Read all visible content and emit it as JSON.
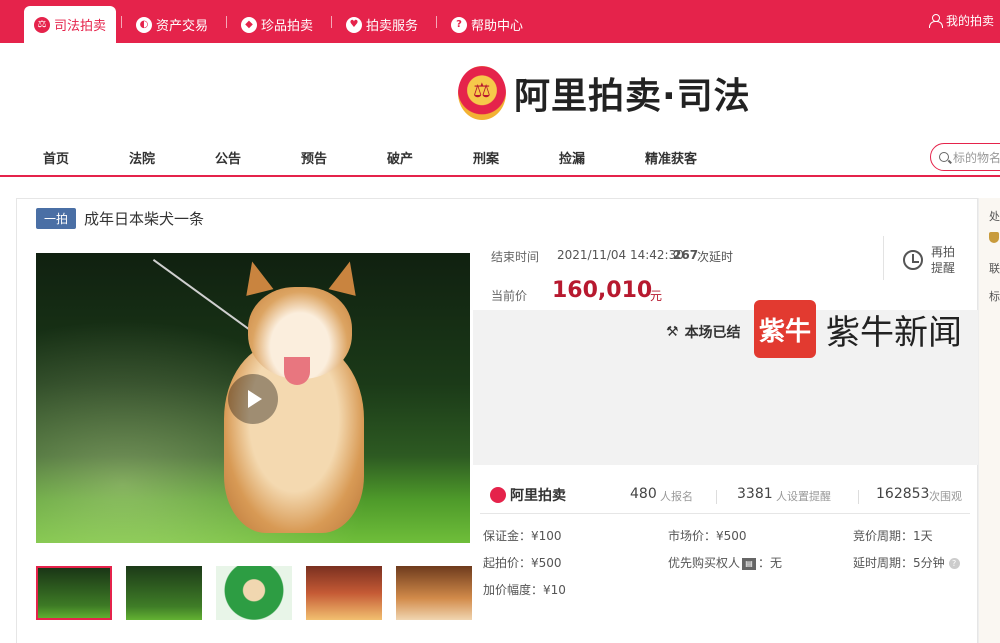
{
  "topbar": {
    "tabs": [
      {
        "label": "司法拍卖",
        "icon": "court-icon",
        "active": true
      },
      {
        "label": "资产交易",
        "icon": "asset-icon",
        "active": false
      },
      {
        "label": "珍品拍卖",
        "icon": "gem-icon",
        "active": false
      },
      {
        "label": "拍卖服务",
        "icon": "heart-icon",
        "active": false
      },
      {
        "label": "帮助中心",
        "icon": "help-icon",
        "active": false
      }
    ],
    "my_auction": "我的拍卖",
    "bg_color": "#e5234b"
  },
  "logo": {
    "text": "阿里拍卖·司法"
  },
  "nav": {
    "items": [
      "首页",
      "法院",
      "公告",
      "预告",
      "破产",
      "刑案",
      "捡漏",
      "精准获客"
    ],
    "search_placeholder": "标的物名"
  },
  "item": {
    "badge": "一拍",
    "title": "成年日本柴犬一条",
    "end_label": "结束时间",
    "end_time": "2021/11/04 14:42:30",
    "delay_count": "267",
    "delay_suffix": "次延时",
    "price_label": "当前价",
    "price": "160,010",
    "price_unit": "元",
    "remind_label": "再拍提醒",
    "ended_text": "本场已结",
    "watermark_box": "紫牛",
    "watermark_text": "紫牛新闻"
  },
  "stats": {
    "brand": "阿里拍卖",
    "signups": "480",
    "signups_label": "人报名",
    "reminders": "3381",
    "reminders_label": "人设置提醒",
    "views": "162853",
    "views_label": "次围观"
  },
  "details": {
    "deposit": "保证金：¥100",
    "market_price": "市场价：¥500",
    "bid_cycle": "竞价周期：1天",
    "start_price": "起拍价：¥500",
    "priority_prefix": "优先购买权人",
    "priority_suffix": "：无",
    "delay_cycle": "延时周期：5分钟",
    "increment": "加价幅度：¥10"
  },
  "side": {
    "s1": "处",
    "s2": "联",
    "s3": "标"
  }
}
